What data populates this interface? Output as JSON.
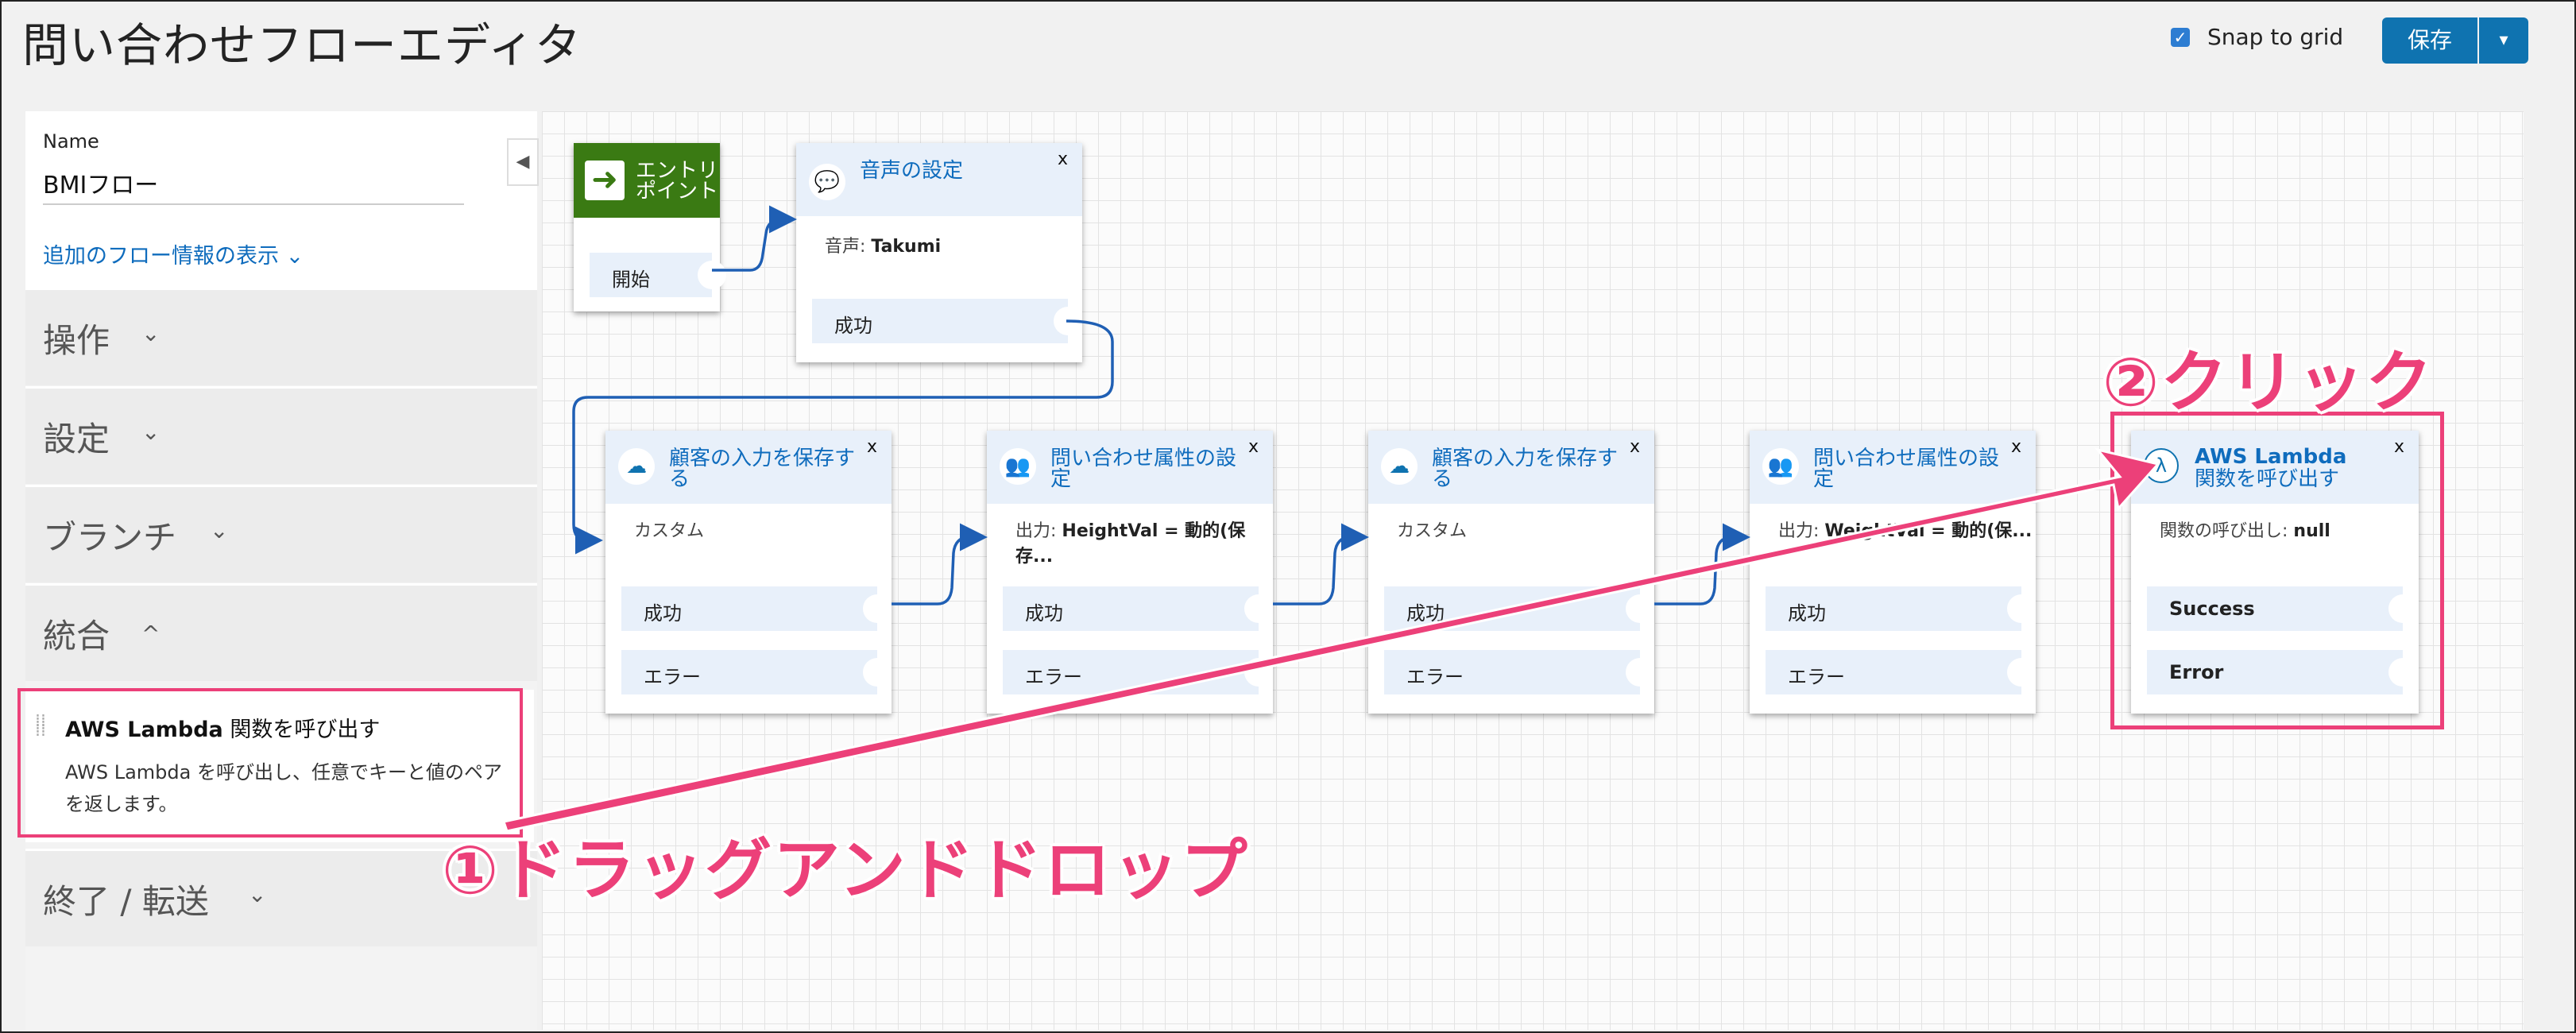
{
  "header": {
    "title": "問い合わせフローエディタ",
    "snap_label": "Snap to grid",
    "snap_checked": "✓",
    "save_label": "保存",
    "save_dropdown": "▾"
  },
  "sidebar": {
    "name_label": "Name",
    "name_value": "BMIフロー",
    "more_info": "追加のフロー情報の表示 ⌄",
    "collapse_icon": "◀",
    "categories": [
      {
        "label": "操作",
        "chevron": "⌄"
      },
      {
        "label": "設定",
        "chevron": "⌄"
      },
      {
        "label": "ブランチ",
        "chevron": "⌄"
      },
      {
        "label": "統合",
        "chevron": "^"
      },
      {
        "label": "終了 / 転送",
        "chevron": "⌄"
      }
    ],
    "lambda_item": {
      "title_bold": "AWS Lambda",
      "title_rest": " 関数を呼び出す",
      "description": "AWS Lambda を呼び出し、任意でキーと値のペアを返します。"
    }
  },
  "blocks": {
    "entry": {
      "title": "エントリポイント",
      "port": "開始"
    },
    "voice": {
      "title": "音声の設定",
      "sub_label": "音声: ",
      "sub_value": "Takumi",
      "port": "成功",
      "close": "x"
    },
    "input1": {
      "title": "顧客の入力を保存する",
      "sub": "カスタム",
      "ports": [
        "成功",
        "エラー"
      ],
      "close": "x"
    },
    "attr1": {
      "title": "問い合わせ属性の設定",
      "sub_label": "出力: ",
      "sub_value": "HeightVal = 動的(保存...",
      "ports": [
        "成功",
        "エラー"
      ],
      "close": "x"
    },
    "input2": {
      "title": "顧客の入力を保存する",
      "sub": "カスタム",
      "ports": [
        "成功",
        "エラー"
      ],
      "close": "x"
    },
    "attr2": {
      "title": "問い合わせ属性の設定",
      "sub_label": "出力: ",
      "sub_value": "WeightVal = 動的(保...",
      "ports": [
        "成功",
        "エラー"
      ],
      "close": "x"
    },
    "lambda": {
      "title_line1": "AWS Lambda",
      "title_line2": "関数を呼び出す",
      "sub_label": "関数の呼び出し: ",
      "sub_value": "null",
      "ports": [
        "Success",
        "Error"
      ],
      "close": "x"
    }
  },
  "annotations": {
    "step1": "①ドラッグアンドドロップ",
    "step2": "②クリック"
  },
  "colors": {
    "accent": "#0f73b0",
    "highlight": "#ec4079",
    "entry_green": "#3a7a13",
    "link": "#0f6cbd"
  }
}
